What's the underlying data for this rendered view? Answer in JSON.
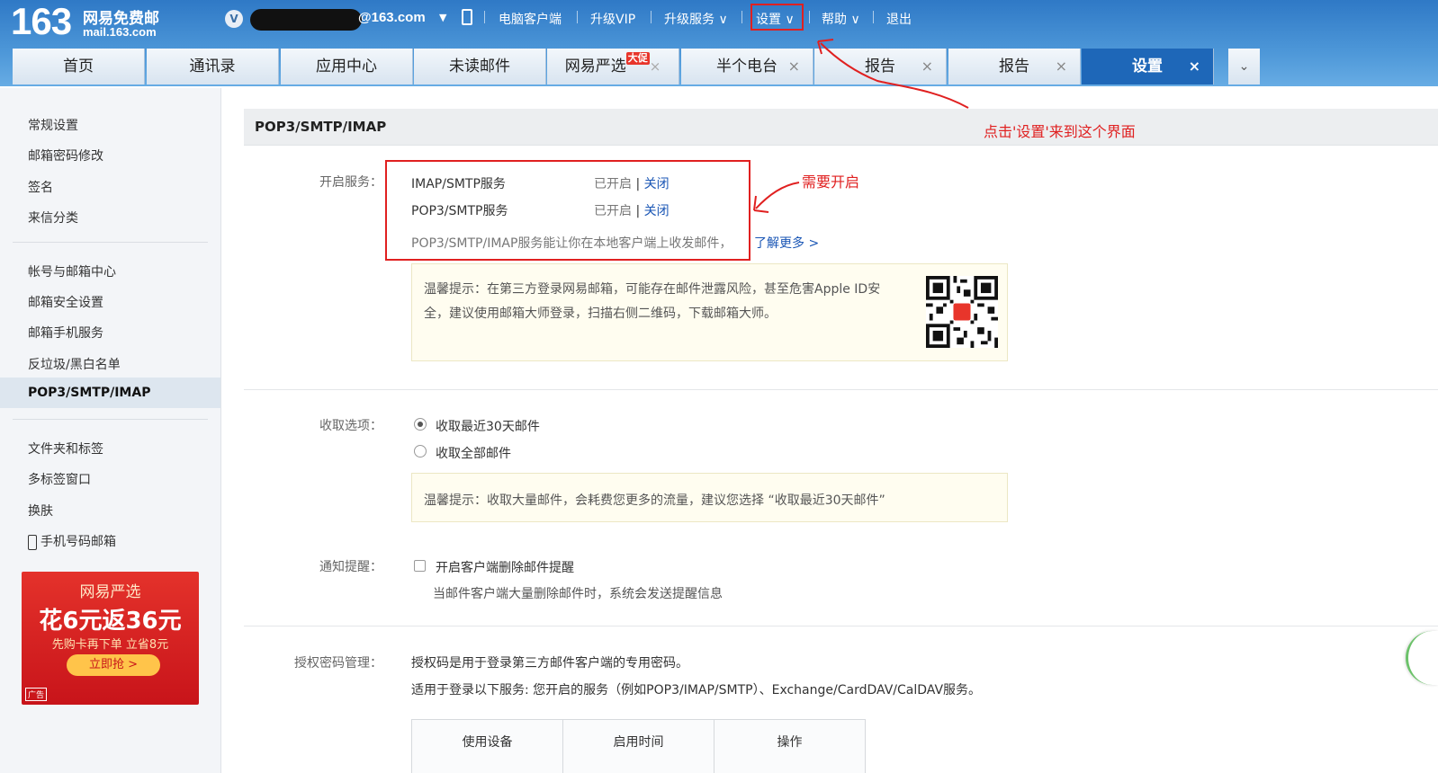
{
  "header": {
    "logo_number": "163",
    "logo_name": "网易免费邮",
    "logo_domain": "mail.163.com",
    "vip_badge": "V",
    "email_visible": "@163.com",
    "nav": {
      "desktop_client": "电脑客户端",
      "upgrade_vip": "升级VIP",
      "upgrade_service": "升级服务",
      "settings": "设置",
      "help": "帮助",
      "logout": "退出"
    },
    "caret": "∨"
  },
  "tabs": {
    "items": [
      {
        "label": "首页"
      },
      {
        "label": "通讯录"
      },
      {
        "label": "应用中心"
      },
      {
        "label": "未读邮件"
      },
      {
        "label": "网易严选",
        "badge": "大促"
      },
      {
        "label": "半个电台"
      },
      {
        "label": "报告"
      },
      {
        "label": "报告"
      },
      {
        "label": "设置"
      }
    ],
    "close": "×",
    "more": "⌄"
  },
  "sidebar": {
    "group1": [
      "常规设置",
      "邮箱密码修改",
      "签名",
      "来信分类"
    ],
    "group2": [
      "帐号与邮箱中心",
      "邮箱安全设置",
      "邮箱手机服务",
      "反垃圾/黑白名单",
      "POP3/SMTP/IMAP"
    ],
    "group3": [
      "文件夹和标签",
      "多标签窗口",
      "换肤",
      "手机号码邮箱"
    ],
    "ad": {
      "brand": "网易严选",
      "headline": "花6元返36元",
      "sub": "先购卡再下单 立省8元",
      "button": "立即抢 >",
      "label": "广告"
    }
  },
  "content": {
    "title": "POP3/SMTP/IMAP",
    "services": {
      "label": "开启服务：",
      "rows": [
        {
          "name": "IMAP/SMTP服务",
          "status": "已开启",
          "sep": "|",
          "action": "关闭"
        },
        {
          "name": "POP3/SMTP服务",
          "status": "已开启",
          "sep": "|",
          "action": "关闭"
        }
      ],
      "desc": "POP3/SMTP/IMAP服务能让你在本地客户端上收发邮件，",
      "learn_more": "了解更多 >",
      "tip_line1": "温馨提示：在第三方登录网易邮箱，可能存在邮件泄露风险，甚至危害Apple ID安",
      "tip_line2": "全，建议使用邮箱大师登录，扫描右侧二维码，下载邮箱大师。"
    },
    "fetch": {
      "label": "收取选项：",
      "option1": "收取最近30天邮件",
      "option2": "收取全部邮件",
      "selected": "option1",
      "tip": "温馨提示：收取大量邮件，会耗费您更多的流量，建议您选择 “收取最近30天邮件”"
    },
    "notify": {
      "label": "通知提醒：",
      "checkbox_label": "开启客户端删除邮件提醒",
      "desc": "当邮件客户端大量删除邮件时，系统会发送提醒信息"
    },
    "auth": {
      "label": "授权密码管理：",
      "line1": "授权码是用于登录第三方邮件客户端的专用密码。",
      "line2": "适用于登录以下服务: 您开启的服务（例如POP3/IMAP/SMTP）、Exchange/CardDAV/CalDAV服务。",
      "columns": [
        "使用设备",
        "启用时间",
        "操作"
      ]
    }
  },
  "annotations": {
    "click_settings": "点击'设置'来到这个界面",
    "need_enable": "需要开启",
    "color": "#e02020"
  }
}
